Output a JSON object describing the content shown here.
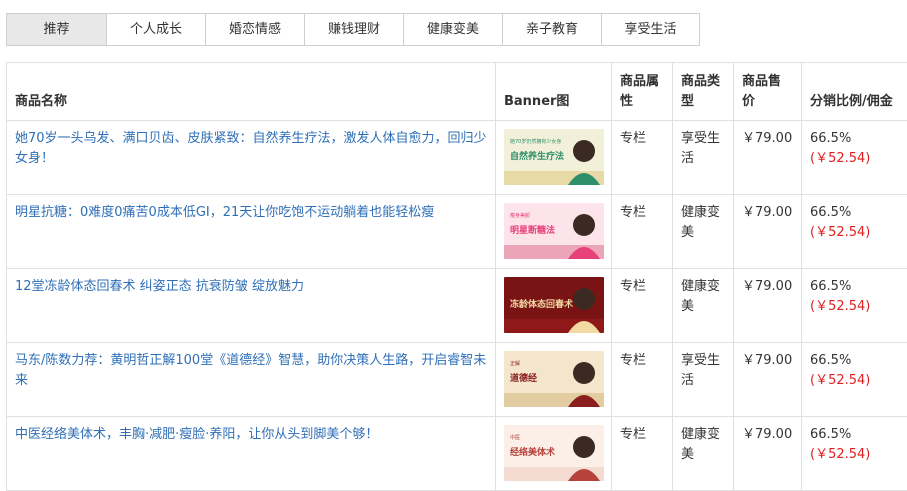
{
  "tabs": [
    "推荐",
    "个人成长",
    "婚恋情感",
    "赚钱理财",
    "健康变美",
    "亲子教育",
    "享受生活"
  ],
  "active_tab": 0,
  "table": {
    "headers": {
      "name": "商品名称",
      "banner": "Banner图",
      "attr": "商品属性",
      "type": "商品类型",
      "price": "商品售价",
      "commission": "分销比例/佣金"
    },
    "rows": [
      {
        "name": "她70岁一头乌发、满口贝齿、皮肤紧致：自然养生疗法，激发人体自愈力，回归少女身！",
        "attr": "专栏",
        "type": "享受生活",
        "price": "￥79.00",
        "ratio": "66.5%",
        "commission": "(￥52.54)",
        "banner": {
          "text": "自然养生疗法",
          "small_text": "她70岁仍然拥有少女身",
          "colors": [
            "#f2f0d8",
            "#2e8f6a",
            "#d8b14a"
          ]
        }
      },
      {
        "name": "明星抗糖：0难度0痛苦0成本低GI，21天让你吃饱不运动躺着也能轻松瘦",
        "attr": "专栏",
        "type": "健康变美",
        "price": "￥79.00",
        "ratio": "66.5%",
        "commission": "(￥52.54)",
        "banner": {
          "text": "明星断糖法",
          "small_text": "瘦身美颜",
          "colors": [
            "#fde3ea",
            "#e8417a",
            "#c92d5d"
          ]
        }
      },
      {
        "name": "12堂冻龄体态回春术 纠姿正态 抗衰防皱 绽放魅力",
        "attr": "专栏",
        "type": "健康变美",
        "price": "￥79.00",
        "ratio": "66.5%",
        "commission": "(￥52.54)",
        "banner": {
          "text": "冻龄体态回春术",
          "small_text": "",
          "colors": [
            "#7a1414",
            "#f3d9a2",
            "#b81f1f"
          ]
        }
      },
      {
        "name": "马东/陈数力荐：黄明哲正解100堂《道德经》智慧，助你决策人生路，开启睿智未来",
        "attr": "专栏",
        "type": "享受生活",
        "price": "￥79.00",
        "ratio": "66.5%",
        "commission": "(￥52.54)",
        "banner": {
          "text": "道德经",
          "small_text": "正解",
          "colors": [
            "#f3e6cc",
            "#8b1e1e",
            "#c49a52"
          ]
        }
      },
      {
        "name": "中医经络美体术，丰胸·减肥·瘦脸·养阳，让你从头到脚美个够！",
        "attr": "专栏",
        "type": "健康变美",
        "price": "￥79.00",
        "ratio": "66.5%",
        "commission": "(￥52.54)",
        "banner": {
          "text": "经络美体术",
          "small_text": "中医",
          "colors": [
            "#fbefe7",
            "#b5433b",
            "#e8b8a8"
          ]
        }
      }
    ]
  }
}
